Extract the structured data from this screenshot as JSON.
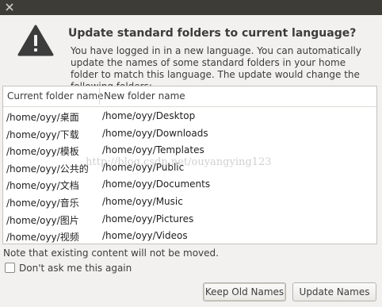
{
  "dialog": {
    "title": "Update standard folders to current language?",
    "description": "You have logged in in a new language. You can automatically update the names of some standard folders in your home folder to match this language. The update would change the following folders:",
    "table": {
      "columns": [
        "Current folder name",
        "New folder name"
      ],
      "rows": [
        [
          "/home/oyy/桌面",
          "/home/oyy/Desktop"
        ],
        [
          "/home/oyy/下载",
          "/home/oyy/Downloads"
        ],
        [
          "/home/oyy/模板",
          "/home/oyy/Templates"
        ],
        [
          "/home/oyy/公共的",
          "/home/oyy/Public"
        ],
        [
          "/home/oyy/文档",
          "/home/oyy/Documents"
        ],
        [
          "/home/oyy/音乐",
          "/home/oyy/Music"
        ],
        [
          "/home/oyy/图片",
          "/home/oyy/Pictures"
        ],
        [
          "/home/oyy/视频",
          "/home/oyy/Videos"
        ]
      ]
    },
    "watermark": "http://blog.csdn.net/ouyangying123",
    "note": "Note that existing content will not be moved.",
    "checkbox_label": "Don't ask me this again",
    "checkbox_checked": false,
    "buttons": {
      "keep": "Keep Old Names",
      "update": "Update Names"
    }
  },
  "icons": {
    "warning": "warning-icon",
    "close": "close-icon"
  },
  "colors": {
    "titlebar": "#3d3c37",
    "dialog_bg": "#f2f1f0",
    "table_bg": "#ffffff"
  }
}
